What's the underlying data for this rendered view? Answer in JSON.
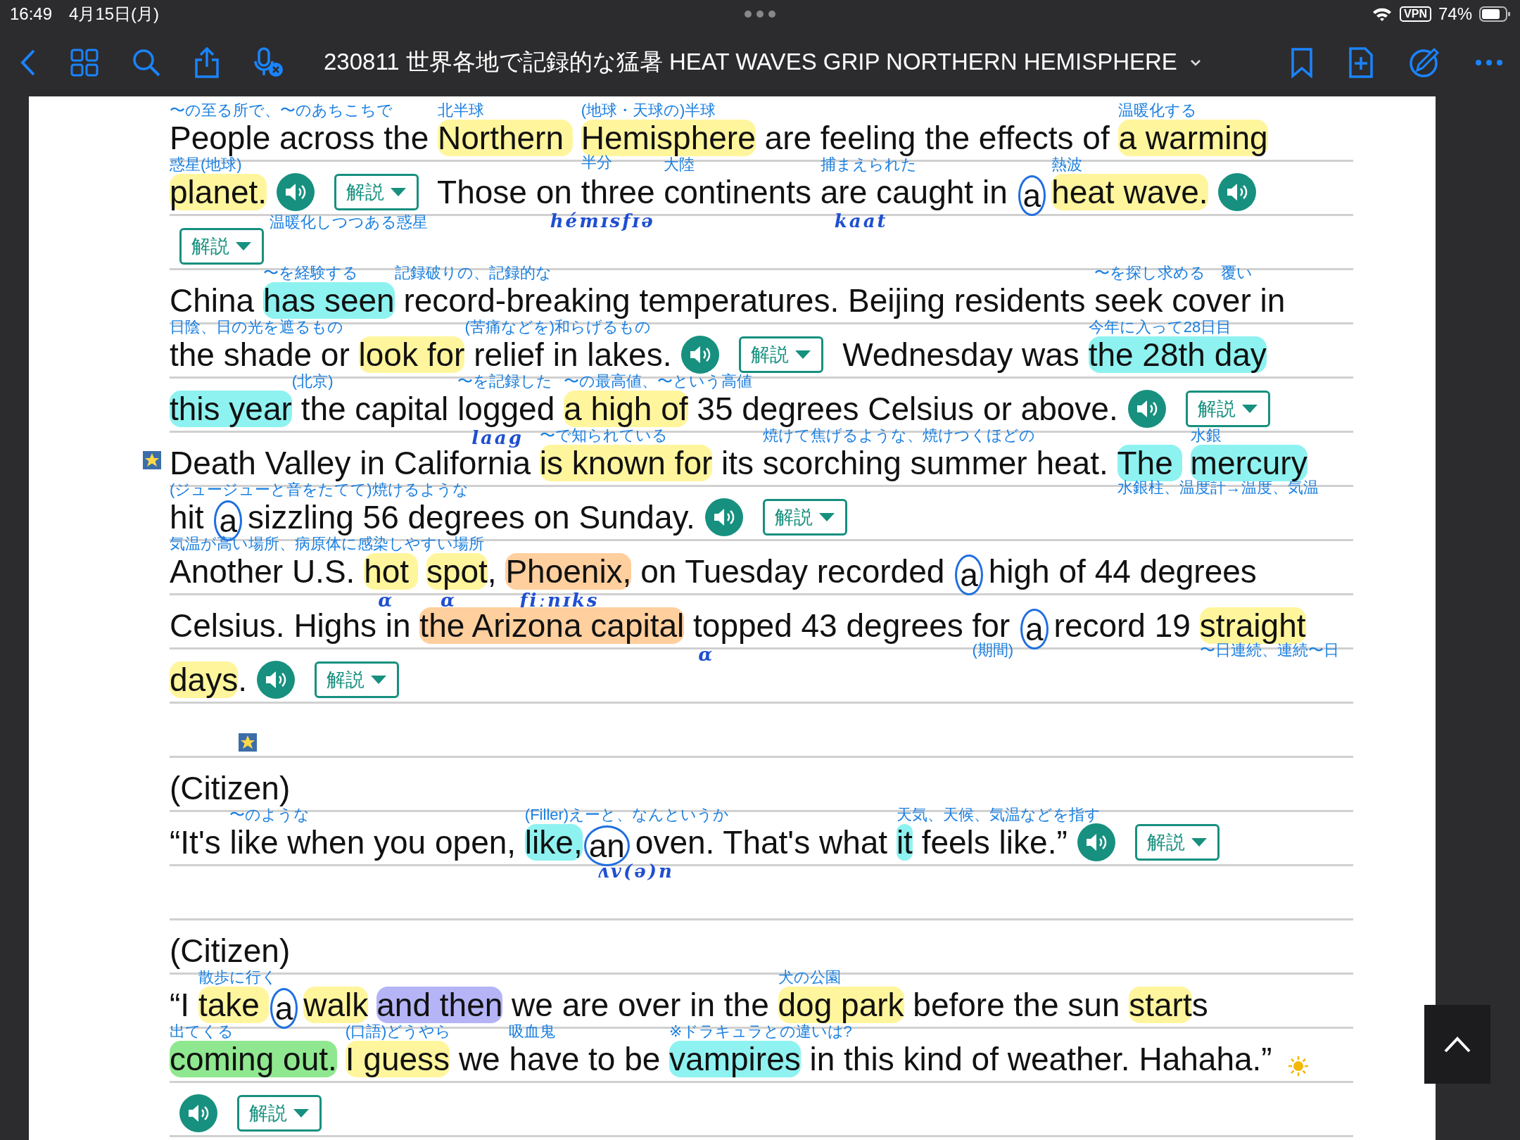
{
  "status_bar": {
    "time": "16:49",
    "date": "4月15日(月)",
    "vpn": "VPN",
    "battery": "74%"
  },
  "toolbar": {
    "title": "230811 世界各地で記録的な猛暑 HEAT WAVES GRIP NORTHERN HEMISPHERE"
  },
  "lines": [
    {
      "items": [
        {
          "kind": "text",
          "text": "People ",
          "gloss": "〜の至る所で、〜のあちこちで"
        },
        {
          "kind": "text",
          "text": "across the "
        },
        {
          "kind": "text",
          "text": "Northern ",
          "color": "#fff59d",
          "gloss": "北半球"
        },
        {
          "kind": "text",
          "text": "Hemisphere",
          "color": "#fff59d",
          "gloss": "(地球・天球の)半球",
          "below": "半分"
        },
        {
          "kind": "text",
          "text": " are feeling the effects of "
        },
        {
          "kind": "text",
          "text": "a warming",
          "color": "#fff59d",
          "gloss": "温暖化する"
        }
      ]
    },
    {
      "items": [
        {
          "kind": "text",
          "text": "planet.",
          "color": "#fff59d",
          "gloss": "惑星(地球)"
        },
        {
          "kind": "speaker",
          "below": "温暖化しつつある惑星"
        },
        {
          "kind": "explain",
          "label": "解説"
        },
        {
          "kind": "text",
          "text": " Those "
        },
        {
          "kind": "text",
          "text": "on three ",
          "ink": "hémɪsfɪə"
        },
        {
          "kind": "text",
          "text": "continents ",
          "gloss": "大陸"
        },
        {
          "kind": "text",
          "text": "are caught ",
          "gloss": "捕まえられた",
          "ink": "kaat"
        },
        {
          "kind": "text",
          "text": "in "
        },
        {
          "kind": "circled",
          "text": "a"
        },
        {
          "kind": "text",
          "text": "heat wave.",
          "color": "#fff59d",
          "gloss": "熱波"
        },
        {
          "kind": "speaker"
        }
      ]
    },
    {
      "items": [
        {
          "kind": "explain",
          "label": "解説"
        }
      ]
    },
    {
      "items": [
        {
          "kind": "text",
          "text": "China "
        },
        {
          "kind": "text",
          "text": "has seen",
          "color": "#8ef2f0",
          "gloss": "〜を経験する"
        },
        {
          "kind": "text",
          "text": " record-breaking ",
          "gloss": "記録破りの、記録的な"
        },
        {
          "kind": "text",
          "text": "temperatures. Beijing residents "
        },
        {
          "kind": "text",
          "text": "seek cover ",
          "gloss": "〜を探し求める　覆い"
        },
        {
          "kind": "text",
          "text": "in"
        }
      ]
    },
    {
      "items": [
        {
          "kind": "text",
          "text": "the shade ",
          "gloss": "日陰、日の光を遮るもの"
        },
        {
          "kind": "text",
          "text": "or "
        },
        {
          "kind": "text",
          "text": "look for",
          "color": "#fff59d"
        },
        {
          "kind": "text",
          "text": " relief ",
          "gloss": "(苦痛などを)和らげるもの"
        },
        {
          "kind": "text",
          "text": "in lakes."
        },
        {
          "kind": "speaker"
        },
        {
          "kind": "explain",
          "label": "解説"
        },
        {
          "kind": "text",
          "text": " Wednesday was "
        },
        {
          "kind": "text",
          "text": "the 28th day",
          "color": "#8ef2f0",
          "gloss": "今年に入って28日目"
        }
      ]
    },
    {
      "items": [
        {
          "kind": "text",
          "text": "this year",
          "color": "#8ef2f0"
        },
        {
          "kind": "text",
          "text": " the capital ",
          "gloss": "(北京)"
        },
        {
          "kind": "text",
          "text": "logged ",
          "gloss": "〜を記録した",
          "ink": "laag"
        },
        {
          "kind": "text",
          "text": "a high of",
          "color": "#fff59d",
          "gloss": "〜の最高値、〜という高値"
        },
        {
          "kind": "text",
          "text": " 35 degrees Celsius or above."
        },
        {
          "kind": "speaker"
        },
        {
          "kind": "explain",
          "label": "解説"
        }
      ]
    },
    {
      "items": [
        {
          "kind": "margin_star"
        },
        {
          "kind": "text",
          "text": "Death Valley in California "
        },
        {
          "kind": "text",
          "text": "is known for",
          "color": "#fff59d",
          "gloss": "〜で知られている"
        },
        {
          "kind": "text",
          "text": " its "
        },
        {
          "kind": "text",
          "text": "scorching ",
          "gloss": "焼けて焦げるような、焼けつくほどの"
        },
        {
          "kind": "text",
          "text": "summer heat. "
        },
        {
          "kind": "text",
          "text": "The ",
          "color": "#8ef2f0",
          "below": "水銀柱、温度計→温度、気温"
        },
        {
          "kind": "text",
          "text": "mercury",
          "color": "#8ef2f0",
          "gloss": "水銀"
        }
      ]
    },
    {
      "items": [
        {
          "kind": "text",
          "text": "hit ",
          "gloss": "(ジュージューと音をたてて)焼けるような"
        },
        {
          "kind": "circled",
          "text": "a"
        },
        {
          "kind": "text",
          "text": "sizzling 56 degrees on Sunday."
        },
        {
          "kind": "speaker"
        },
        {
          "kind": "explain",
          "label": "解説"
        }
      ]
    },
    {
      "items": [
        {
          "kind": "text",
          "text": "Another U.S. ",
          "gloss": "気温が高い場所、病原体に感染しやすい場所"
        },
        {
          "kind": "text",
          "text": "hot ",
          "color": "#fff59d",
          "ink": "ɑ"
        },
        {
          "kind": "text",
          "text": "spot",
          "color": "#fff59d",
          "ink": "ɑ"
        },
        {
          "kind": "text",
          "text": ", "
        },
        {
          "kind": "text",
          "text": "Phoenix,",
          "color": "#ffcf9e",
          "ink": "fiːnɪks"
        },
        {
          "kind": "text",
          "text": " on Tuesday recorded "
        },
        {
          "kind": "circled",
          "text": "a"
        },
        {
          "kind": "text",
          "text": "high of 44 degrees"
        }
      ]
    },
    {
      "items": [
        {
          "kind": "text",
          "text": "Celsius. Highs in "
        },
        {
          "kind": "text",
          "text": "the Arizona capital",
          "color": "#ffcf9e"
        },
        {
          "kind": "text",
          "text": " topped ",
          "ink": "ɑ"
        },
        {
          "kind": "text",
          "text": "43 degrees "
        },
        {
          "kind": "text",
          "text": "for ",
          "below": "(期間)"
        },
        {
          "kind": "circled",
          "text": "a"
        },
        {
          "kind": "text",
          "text": "record 19 "
        },
        {
          "kind": "text",
          "text": "straight",
          "color": "#fff59d",
          "below": "〜日連続、連続〜日"
        }
      ]
    },
    {
      "items": [
        {
          "kind": "text",
          "text": "days",
          "color": "#fff59d"
        },
        {
          "kind": "text",
          "text": "."
        },
        {
          "kind": "speaker"
        },
        {
          "kind": "explain",
          "label": "解説"
        }
      ]
    },
    {
      "items": [
        {
          "kind": "star"
        }
      ]
    },
    {
      "items": [
        {
          "kind": "text",
          "text": "(Citizen)"
        }
      ]
    },
    {
      "blank_after": true,
      "items": [
        {
          "kind": "text",
          "text": "“It's "
        },
        {
          "kind": "text",
          "text": "like ",
          "gloss": "〜のような"
        },
        {
          "kind": "text",
          "text": "when you open, "
        },
        {
          "kind": "text",
          "text": "like,",
          "color": "#8ef2f0",
          "gloss": "(Filler)えーと、なんというか"
        },
        {
          "kind": "circled",
          "text": "an",
          "ink": "ʌv(ə)n"
        },
        {
          "kind": "text",
          "text": "oven. That's what "
        },
        {
          "kind": "text",
          "text": "it",
          "color": "#8ef2f0",
          "gloss": "天気、天候、気温などを指す"
        },
        {
          "kind": "text",
          "text": " feels like.”"
        },
        {
          "kind": "speaker"
        },
        {
          "kind": "explain",
          "label": "解説"
        }
      ]
    },
    {
      "items": [
        {
          "kind": "text",
          "text": "(Citizen)"
        }
      ]
    },
    {
      "items": [
        {
          "kind": "text",
          "text": "“I "
        },
        {
          "kind": "text",
          "text": "take ",
          "color": "#fff59d",
          "gloss": "散歩に行く"
        },
        {
          "kind": "circled",
          "text": "a"
        },
        {
          "kind": "text",
          "text": "walk",
          "color": "#fff59d"
        },
        {
          "kind": "text",
          "text": "and then",
          "color": "#b4b4f6"
        },
        {
          "kind": "text",
          "text": " we are over in the "
        },
        {
          "kind": "text",
          "text": "dog park",
          "color": "#fff59d",
          "gloss": "犬の公園"
        },
        {
          "kind": "text",
          "text": " before the sun "
        },
        {
          "kind": "text",
          "text": "start",
          "color": "#fff59d"
        },
        {
          "kind": "text",
          "text": "s"
        }
      ]
    },
    {
      "items": [
        {
          "kind": "text",
          "text": "coming out.",
          "color": "#8fe88f",
          "gloss": "出てくる"
        },
        {
          "kind": "text",
          "text": "I guess",
          "color": "#fff59d",
          "gloss": "(口語)どうやら"
        },
        {
          "kind": "text",
          "text": " we "
        },
        {
          "kind": "text",
          "text": "have to be ",
          "gloss": "吸血鬼"
        },
        {
          "kind": "text",
          "text": "vampires",
          "color": "#8ef2f0",
          "gloss": "※ドラキュラとの違いは?"
        },
        {
          "kind": "text",
          "text": " in this kind of weather. Hahaha.”"
        },
        {
          "kind": "sun"
        }
      ]
    },
    {
      "items": [
        {
          "kind": "speaker"
        },
        {
          "kind": "explain",
          "label": "解説"
        }
      ]
    }
  ]
}
